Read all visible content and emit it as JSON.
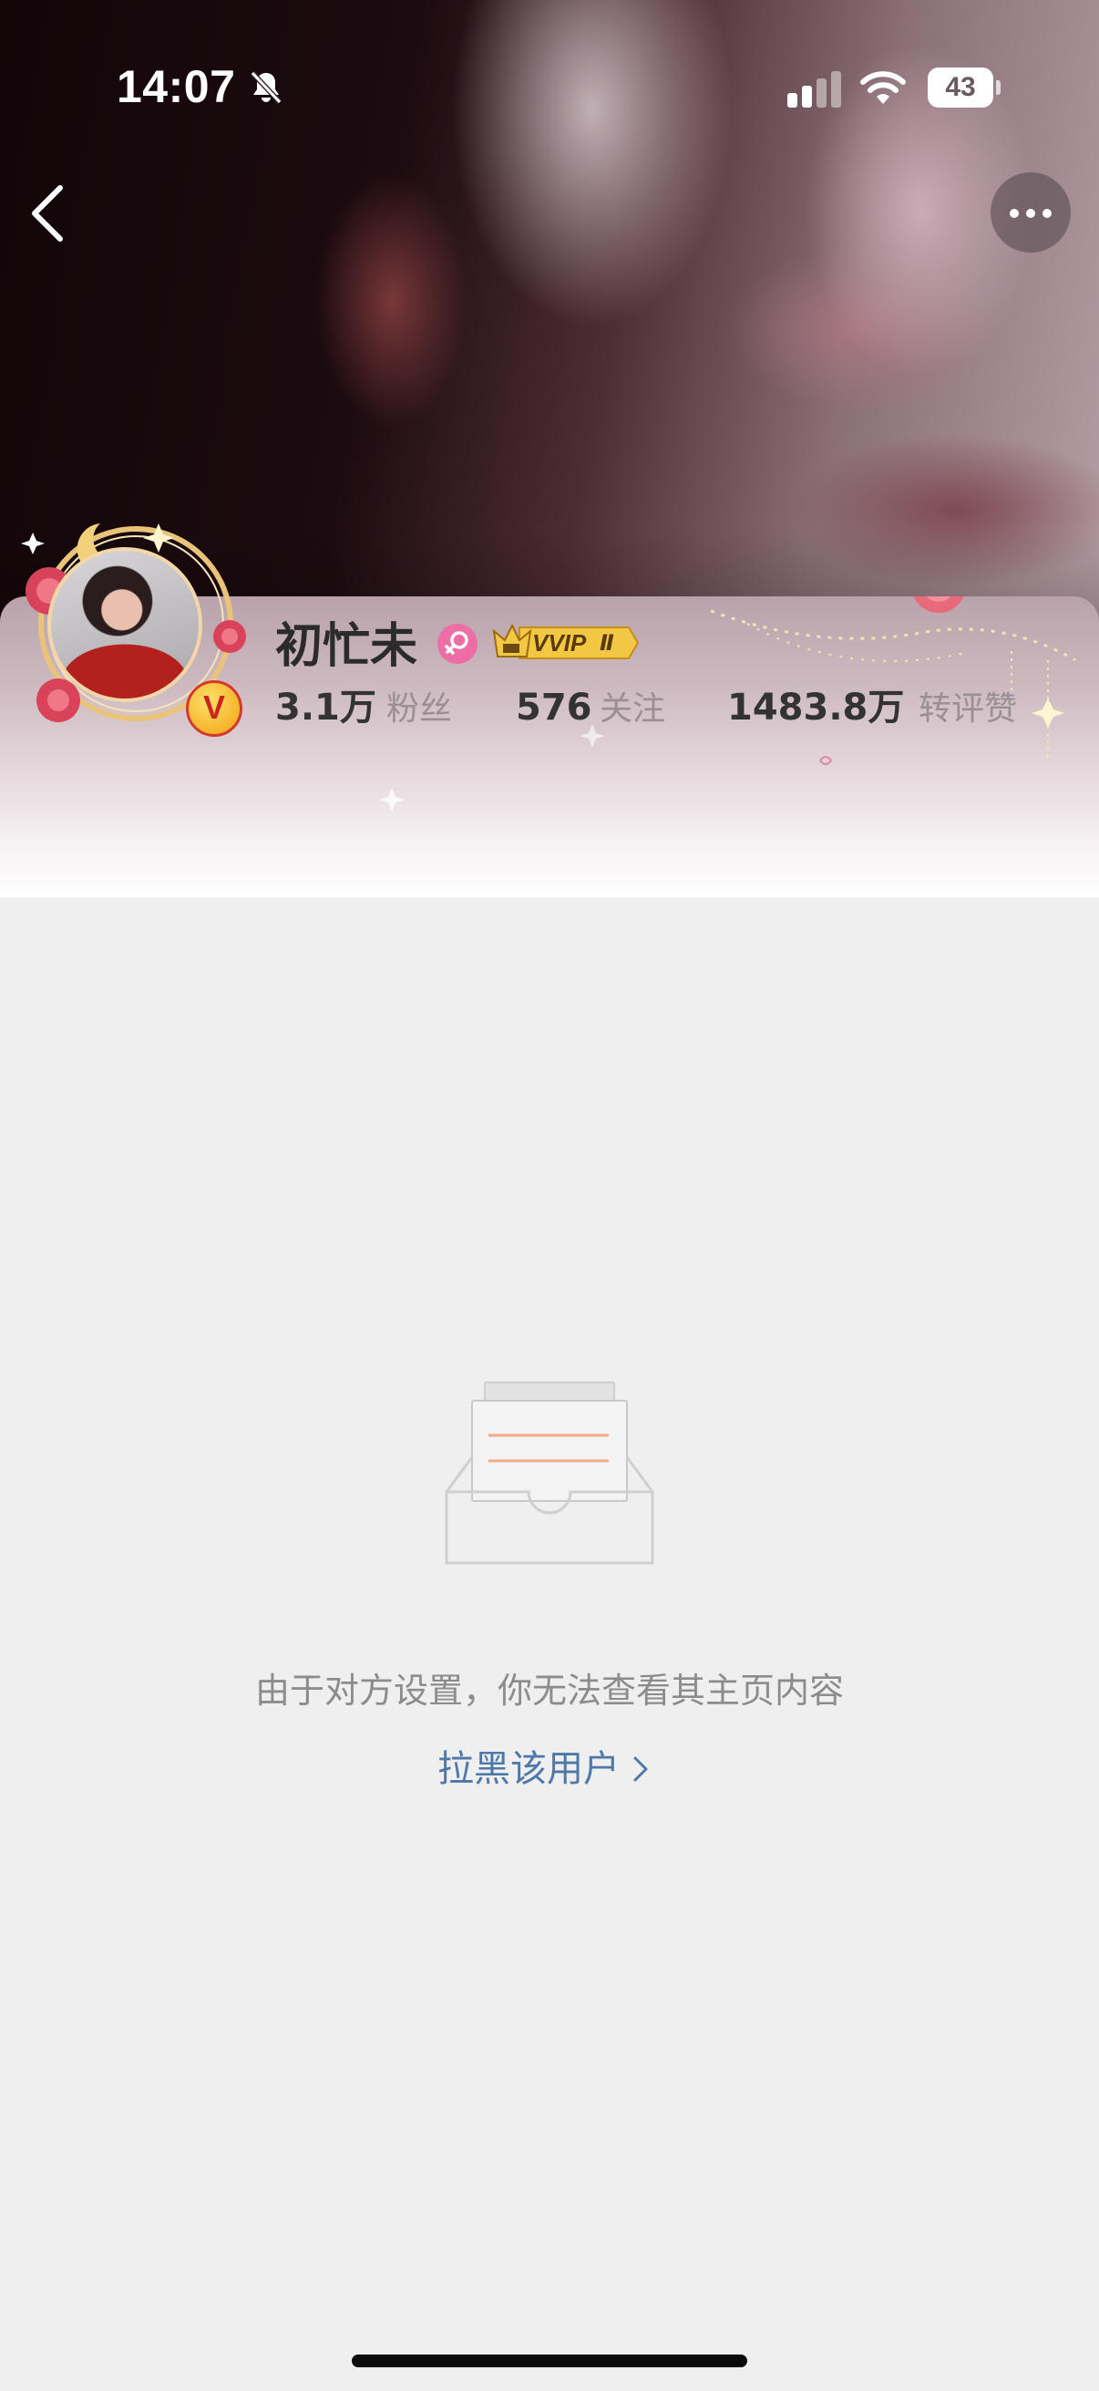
{
  "status_bar": {
    "time": "14:07",
    "battery": "43",
    "icons": [
      "bell-slash-icon",
      "cellular-signal-icon",
      "wifi-icon",
      "battery-icon"
    ]
  },
  "nav": {
    "back_icon": "chevron-left-icon",
    "more_icon": "ellipsis-icon"
  },
  "profile": {
    "name": "初忙未",
    "gender_icon": "female-icon",
    "vip_label": "VVIP",
    "vip_level": "Ⅱ",
    "verified_label": "V",
    "stats": [
      {
        "value": "3.1万",
        "label": "粉丝"
      },
      {
        "value": "576",
        "label": "关注"
      },
      {
        "value": "1483.8万",
        "label": "转评赞"
      }
    ]
  },
  "empty_state": {
    "icon": "empty-inbox-icon",
    "message": "由于对方设置，你无法查看其主页内容",
    "action": "拉黑该用户"
  },
  "colors": {
    "background": "#efefef",
    "link": "#4d78a8",
    "accent_pink": "#ec6ea4",
    "vip_gold": "#f2c744"
  }
}
